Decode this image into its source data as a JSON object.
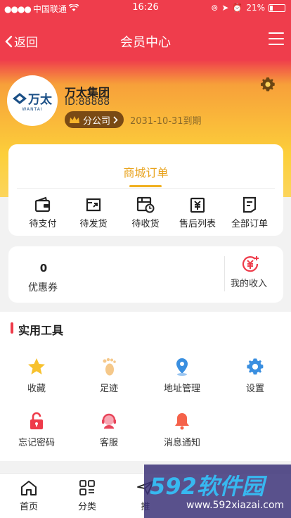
{
  "status_bar": {
    "carrier": "中国联通",
    "time": "16:26",
    "battery": "21%",
    "battery_level": 0.21
  },
  "nav": {
    "back_label": "返回",
    "title": "会员中心"
  },
  "profile": {
    "company_name": "万太集团",
    "logo_text": "万太",
    "logo_subtext": "WANTAI",
    "id_text": "ID:88888",
    "badge_label": "分公司",
    "expire_text": "2031-10-31到期"
  },
  "orders": {
    "title": "商城订单",
    "items": [
      {
        "label": "待支付",
        "icon": "wallet-icon"
      },
      {
        "label": "待发货",
        "icon": "package-out-icon"
      },
      {
        "label": "待收货",
        "icon": "receive-icon"
      },
      {
        "label": "售后列表",
        "icon": "after-sale-icon"
      },
      {
        "label": "全部订单",
        "icon": "order-list-icon"
      }
    ]
  },
  "income": {
    "coupon_count": "0",
    "coupon_label": "优惠券",
    "my_income_label": "我的收入"
  },
  "tools": {
    "title": "实用工具",
    "items": [
      {
        "label": "收藏",
        "icon": "star-icon"
      },
      {
        "label": "足迹",
        "icon": "footprint-icon"
      },
      {
        "label": "地址管理",
        "icon": "location-icon"
      },
      {
        "label": "设置",
        "icon": "settings-icon"
      },
      {
        "label": "忘记密码",
        "icon": "lock-icon"
      },
      {
        "label": "客服",
        "icon": "customer-service-icon"
      },
      {
        "label": "消息通知",
        "icon": "bell-icon"
      }
    ]
  },
  "tabbar": {
    "items": [
      {
        "label": "首页",
        "icon": "home-icon"
      },
      {
        "label": "分类",
        "icon": "category-icon"
      },
      {
        "label": "推",
        "icon": "send-icon"
      }
    ]
  },
  "watermark": {
    "brand": "592软件园",
    "url": "www.592xiazai.com"
  },
  "colors": {
    "primary_red": "#ef3d4c",
    "gold": "#fcd55c",
    "accent_orange": "#e8a21b",
    "badge_brown": "#7a4a14"
  }
}
